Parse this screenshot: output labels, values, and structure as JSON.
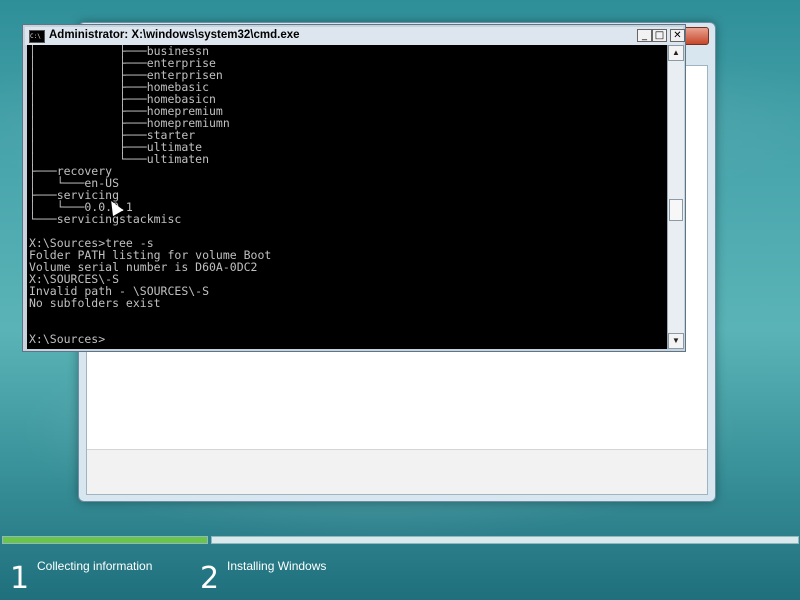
{
  "cmd_window": {
    "title": "Administrator: X:\\windows\\system32\\cmd.exe",
    "icon_text": "C:\\",
    "buttons": {
      "minimize": "_",
      "maximize": "□",
      "close": "✕"
    },
    "console_text": "│            ├───businessn\n│            ├───enterprise\n│            ├───enterprisen\n│            ├───homebasic\n│            ├───homebasicn\n│            ├───homepremium\n│            ├───homepremiumn\n│            ├───starter\n│            ├───ultimate\n│            └───ultimaten\n├───recovery\n│   └───en-US\n├───servicing\n│   └───0.0.0.1\n└───servicingstackmisc\n\nX:\\Sources>tree -s\nFolder PATH listing for volume Boot\nVolume serial number is D60A-0DC2\nX:\\SOURCES\\-S\nInvalid path - \\SOURCES\\-S\nNo subfolders exist\n\n\nX:\\Sources>",
    "scrollbar": {
      "up_arrow": "▲",
      "down_arrow": "▼"
    }
  },
  "progress": {
    "steps": [
      {
        "number": "1",
        "label": "Collecting information",
        "complete": 1.0
      },
      {
        "number": "2",
        "label": "Installing Windows",
        "complete": 0.0
      }
    ]
  },
  "colors": {
    "console_bg": "#000000",
    "console_text": "#c0c0c0",
    "progress_green": "#6cc54b"
  }
}
